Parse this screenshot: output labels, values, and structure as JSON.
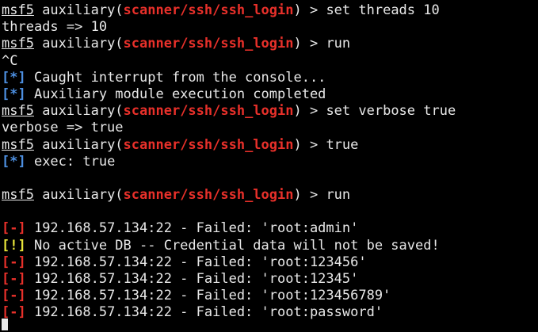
{
  "prompt": {
    "host": "msf5",
    "context": "auxiliary",
    "module": "scanner/ssh/ssh_login",
    "open": "(",
    "close": ")",
    "arrow": " > "
  },
  "lines": [
    {
      "type": "prompt",
      "command": "set threads 10"
    },
    {
      "type": "output",
      "text": "threads => 10"
    },
    {
      "type": "prompt",
      "command": "run"
    },
    {
      "type": "output",
      "text": "^C"
    },
    {
      "type": "status",
      "tag": "[*]",
      "level": "info",
      "text": " Caught interrupt from the console..."
    },
    {
      "type": "status",
      "tag": "[*]",
      "level": "info",
      "text": " Auxiliary module execution completed"
    },
    {
      "type": "prompt",
      "command": "set verbose true"
    },
    {
      "type": "output",
      "text": "verbose => true"
    },
    {
      "type": "prompt",
      "command": "true"
    },
    {
      "type": "status",
      "tag": "[*]",
      "level": "info",
      "text": " exec: true"
    },
    {
      "type": "blank"
    },
    {
      "type": "prompt",
      "command": "run"
    },
    {
      "type": "blank"
    },
    {
      "type": "status",
      "tag": "[-]",
      "level": "error",
      "text": " 192.168.57.134:22 - Failed: 'root:admin'"
    },
    {
      "type": "status",
      "tag": "[!]",
      "level": "warn",
      "text": " No active DB -- Credential data will not be saved!"
    },
    {
      "type": "status",
      "tag": "[-]",
      "level": "error",
      "text": " 192.168.57.134:22 - Failed: 'root:123456'"
    },
    {
      "type": "status",
      "tag": "[-]",
      "level": "error",
      "text": " 192.168.57.134:22 - Failed: 'root:12345'"
    },
    {
      "type": "status",
      "tag": "[-]",
      "level": "error",
      "text": " 192.168.57.134:22 - Failed: 'root:123456789'"
    },
    {
      "type": "status",
      "tag": "[-]",
      "level": "error",
      "text": " 192.168.57.134:22 - Failed: 'root:password'"
    }
  ],
  "colors": {
    "background": "#000000",
    "foreground": "#e8e8e8",
    "module": "#e8302a",
    "info": "#4d8fe0",
    "error": "#e8302a",
    "warn": "#e8e43a"
  }
}
